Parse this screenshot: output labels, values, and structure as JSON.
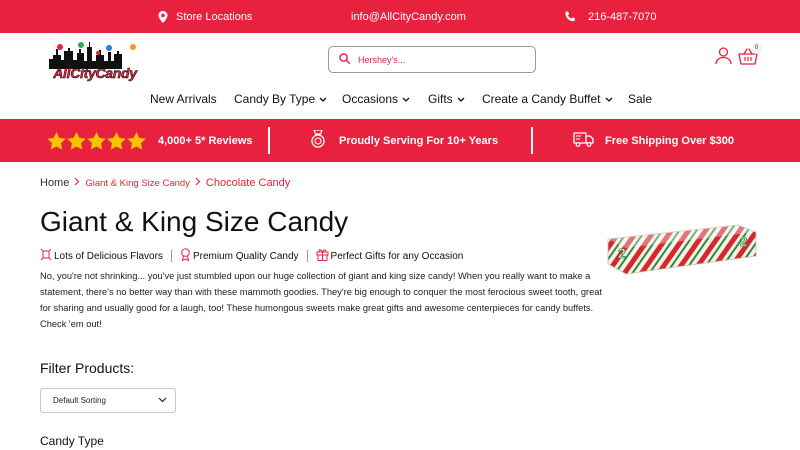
{
  "topbar": {
    "store_locations": "Store Locations",
    "email": "info@AllCityCandy.com",
    "phone": "216-487-7070"
  },
  "header": {
    "logo_text": "AllCityCandy",
    "search_placeholder": "Hershey's...",
    "cart_count": "0"
  },
  "nav": {
    "items": [
      {
        "label": "New Arrivals",
        "dropdown": false
      },
      {
        "label": "Candy By Type",
        "dropdown": true
      },
      {
        "label": "Occasions",
        "dropdown": true
      },
      {
        "label": "Gifts",
        "dropdown": true
      },
      {
        "label": "Create a Candy Buffet",
        "dropdown": true
      },
      {
        "label": "Sale",
        "dropdown": false
      }
    ]
  },
  "promo": {
    "rating_stars": 5,
    "reviews": "4,000+ 5* Reviews",
    "serving": "Proudly Serving For 10+ Years",
    "shipping": "Free Shipping Over $300"
  },
  "breadcrumb": {
    "home": "Home",
    "parent": "Giant & King Size Candy",
    "current": "Chocolate Candy"
  },
  "page": {
    "title": "Giant & King Size Candy",
    "features": [
      "Lots of Delicious Flavors",
      "Premium Quality Candy",
      "Perfect Gifts for any Occasion"
    ],
    "description": "No, you're not shrinking... you've just stumbled upon our huge collection of giant and king size candy! When you really want to make a statement, there's no better way than with these mammoth goodies. They're big enough to conquer the most ferocious sweet tooth, great for sharing and usually good for a laugh, too! These humongous sweets make great gifts and awesome centerpieces for candy buffets. Check 'em out!"
  },
  "filter": {
    "title": "Filter Products:",
    "sort_selected": "Default Sorting",
    "candy_type_label": "Candy Type"
  },
  "colors": {
    "brand_red": "#e8213f",
    "star_yellow": "#f7c200"
  }
}
